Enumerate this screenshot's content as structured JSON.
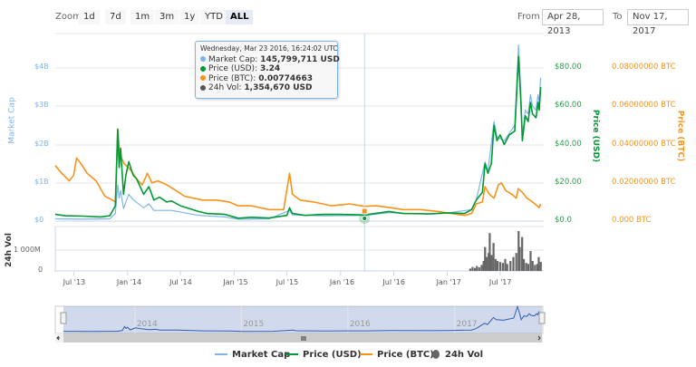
{
  "zoom": {
    "label": "Zoom",
    "buttons": [
      "1d",
      "7d",
      "1m",
      "3m",
      "1y",
      "YTD",
      "ALL"
    ],
    "selected": "ALL"
  },
  "range": {
    "from_label": "From",
    "from": "Apr 28, 2013",
    "to_label": "To",
    "to": "Nov 17, 2017"
  },
  "tooltip": {
    "date": "Wednesday, Mar 23 2016, 16:24:02 UTC",
    "rows": [
      {
        "label": "Market Cap:",
        "value": "145,799,711 USD",
        "color": "#7cb5ec"
      },
      {
        "label": "Price (USD):",
        "value": "3.24",
        "color": "#009933"
      },
      {
        "label": "Price (BTC):",
        "value": "0.00774663",
        "color": "#f7931a"
      },
      {
        "label": "24h Vol:",
        "value": "1,354,670 USD",
        "color": "#555555"
      }
    ]
  },
  "legend": [
    "Market Cap",
    "Price (USD)",
    "Price (BTC)",
    "24h Vol"
  ],
  "colors": {
    "market_cap": "#7cb5ec",
    "price_usd": "#009933",
    "price_btc": "#f7931a",
    "volume": "#666666"
  },
  "chart_data": {
    "type": "line",
    "x_range": [
      "2013-04-28",
      "2017-11-17"
    ],
    "crosshair_date": "2016-03-23",
    "x_ticks": [
      "Jul '13",
      "Jan '14",
      "Jul '14",
      "Jan '15",
      "Jul '15",
      "Jan '16",
      "Jul '16",
      "Jan '17",
      "Jul '17"
    ],
    "x_tick_dates": [
      "2013-07-01",
      "2014-01-01",
      "2014-07-01",
      "2015-01-01",
      "2015-07-01",
      "2016-01-01",
      "2016-07-01",
      "2017-01-01",
      "2017-07-01"
    ],
    "axes": {
      "market_cap": {
        "title": "Market Cap",
        "ticks": [
          "$0",
          "$1B",
          "$2B",
          "$3B",
          "$4B"
        ],
        "range": [
          0,
          4
        ]
      },
      "price_usd": {
        "title": "Price (USD)",
        "ticks": [
          "$0.0",
          "$20.00",
          "$40.00",
          "$60.00",
          "$80.00"
        ],
        "range": [
          0,
          80
        ]
      },
      "price_btc": {
        "title": "Price (BTC)",
        "ticks": [
          "0.000 BTC",
          "0.02000000 BTC",
          "0.04000000 BTC",
          "0.06000000 BTC",
          "0.08000000 BTC"
        ],
        "range": [
          0,
          0.08
        ]
      },
      "volume": {
        "title": "24h Vol",
        "ticks": [
          "0",
          "1 000M"
        ],
        "range": [
          0,
          2000
        ]
      }
    },
    "navigator_years": [
      "2014",
      "2015",
      "2016",
      "2017"
    ],
    "series": [
      {
        "name": "Price (USD)",
        "key": "price_usd",
        "points": [
          [
            "2013-04-28",
            3.5
          ],
          [
            "2013-06-01",
            2.8
          ],
          [
            "2013-08-01",
            2.6
          ],
          [
            "2013-10-01",
            2.2
          ],
          [
            "2013-11-01",
            2.8
          ],
          [
            "2013-11-20",
            8
          ],
          [
            "2013-11-28",
            48
          ],
          [
            "2013-12-03",
            28
          ],
          [
            "2013-12-08",
            38
          ],
          [
            "2013-12-18",
            14
          ],
          [
            "2013-12-26",
            24
          ],
          [
            "2014-01-05",
            31
          ],
          [
            "2014-01-20",
            24
          ],
          [
            "2014-02-01",
            22
          ],
          [
            "2014-02-25",
            14
          ],
          [
            "2014-03-15",
            18
          ],
          [
            "2014-04-01",
            11
          ],
          [
            "2014-04-20",
            12.5
          ],
          [
            "2014-05-15",
            10
          ],
          [
            "2014-06-01",
            10.5
          ],
          [
            "2014-07-01",
            8
          ],
          [
            "2014-09-01",
            5
          ],
          [
            "2014-10-01",
            4
          ],
          [
            "2014-12-01",
            3.5
          ],
          [
            "2015-01-15",
            1.5
          ],
          [
            "2015-03-01",
            2
          ],
          [
            "2015-05-01",
            1.6
          ],
          [
            "2015-07-01",
            3
          ],
          [
            "2015-07-10",
            7
          ],
          [
            "2015-07-20",
            4
          ],
          [
            "2015-09-01",
            3
          ],
          [
            "2015-11-01",
            3.5
          ],
          [
            "2016-01-01",
            3.5
          ],
          [
            "2016-03-23",
            3.24
          ],
          [
            "2016-06-15",
            5
          ],
          [
            "2016-08-01",
            4
          ],
          [
            "2016-11-01",
            3.8
          ],
          [
            "2017-01-01",
            4.3
          ],
          [
            "2017-03-01",
            4
          ],
          [
            "2017-03-25",
            6
          ],
          [
            "2017-04-10",
            11
          ],
          [
            "2017-05-01",
            15
          ],
          [
            "2017-05-10",
            30
          ],
          [
            "2017-05-20",
            25
          ],
          [
            "2017-06-01",
            30
          ],
          [
            "2017-06-10",
            50
          ],
          [
            "2017-06-20",
            42
          ],
          [
            "2017-07-01",
            45
          ],
          [
            "2017-07-15",
            40
          ],
          [
            "2017-08-01",
            45
          ],
          [
            "2017-08-20",
            47
          ],
          [
            "2017-09-02",
            86
          ],
          [
            "2017-09-10",
            62
          ],
          [
            "2017-09-15",
            42
          ],
          [
            "2017-09-25",
            55
          ],
          [
            "2017-10-05",
            52
          ],
          [
            "2017-10-13",
            62
          ],
          [
            "2017-10-20",
            56
          ],
          [
            "2017-11-01",
            54
          ],
          [
            "2017-11-08",
            62
          ],
          [
            "2017-11-12",
            58
          ],
          [
            "2017-11-17",
            70
          ]
        ]
      },
      {
        "name": "Market Cap",
        "key": "market_cap",
        "points": [
          [
            "2013-04-28",
            0.06
          ],
          [
            "2013-08-01",
            0.05
          ],
          [
            "2013-11-01",
            0.06
          ],
          [
            "2013-11-20",
            0.2
          ],
          [
            "2013-11-28",
            0.95
          ],
          [
            "2013-12-03",
            0.6
          ],
          [
            "2013-12-08",
            0.8
          ],
          [
            "2013-12-18",
            0.33
          ],
          [
            "2014-01-05",
            0.7
          ],
          [
            "2014-01-20",
            0.56
          ],
          [
            "2014-02-25",
            0.35
          ],
          [
            "2014-03-15",
            0.45
          ],
          [
            "2014-04-01",
            0.28
          ],
          [
            "2014-06-01",
            0.28
          ],
          [
            "2014-09-01",
            0.15
          ],
          [
            "2014-12-01",
            0.11
          ],
          [
            "2015-01-15",
            0.05
          ],
          [
            "2015-05-01",
            0.06
          ],
          [
            "2015-07-10",
            0.28
          ],
          [
            "2015-07-20",
            0.16
          ],
          [
            "2015-11-01",
            0.14
          ],
          [
            "2016-03-23",
            0.146
          ],
          [
            "2016-06-15",
            0.22
          ],
          [
            "2016-11-01",
            0.18
          ],
          [
            "2017-01-01",
            0.21
          ],
          [
            "2017-03-25",
            0.3
          ],
          [
            "2017-04-10",
            0.55
          ],
          [
            "2017-05-10",
            1.55
          ],
          [
            "2017-05-20",
            1.3
          ],
          [
            "2017-06-10",
            2.6
          ],
          [
            "2017-06-20",
            2.2
          ],
          [
            "2017-07-15",
            2.1
          ],
          [
            "2017-08-20",
            2.5
          ],
          [
            "2017-09-02",
            4.6
          ],
          [
            "2017-09-10",
            3.3
          ],
          [
            "2017-09-15",
            2.2
          ],
          [
            "2017-09-25",
            2.9
          ],
          [
            "2017-10-05",
            2.8
          ],
          [
            "2017-10-13",
            3.3
          ],
          [
            "2017-10-20",
            3.0
          ],
          [
            "2017-11-01",
            2.9
          ],
          [
            "2017-11-08",
            3.3
          ],
          [
            "2017-11-12",
            3.1
          ],
          [
            "2017-11-17",
            3.75
          ]
        ]
      },
      {
        "name": "Price (BTC)",
        "key": "price_btc",
        "points": [
          [
            "2013-04-28",
            0.029
          ],
          [
            "2013-05-20",
            0.025
          ],
          [
            "2013-06-15",
            0.021
          ],
          [
            "2013-06-30",
            0.024
          ],
          [
            "2013-07-10",
            0.033
          ],
          [
            "2013-07-25",
            0.03
          ],
          [
            "2013-08-15",
            0.025
          ],
          [
            "2013-09-15",
            0.021
          ],
          [
            "2013-10-15",
            0.013
          ],
          [
            "2013-11-10",
            0.011
          ],
          [
            "2013-11-20",
            0.01
          ],
          [
            "2013-11-28",
            0.048
          ],
          [
            "2013-12-05",
            0.035
          ],
          [
            "2013-12-20",
            0.03
          ],
          [
            "2014-01-10",
            0.027
          ],
          [
            "2014-02-01",
            0.022
          ],
          [
            "2014-02-20",
            0.019
          ],
          [
            "2014-03-10",
            0.025
          ],
          [
            "2014-03-25",
            0.02
          ],
          [
            "2014-04-15",
            0.021
          ],
          [
            "2014-05-15",
            0.019
          ],
          [
            "2014-06-15",
            0.016
          ],
          [
            "2014-07-15",
            0.013
          ],
          [
            "2014-08-15",
            0.012
          ],
          [
            "2014-09-15",
            0.011
          ],
          [
            "2014-11-01",
            0.011
          ],
          [
            "2014-12-15",
            0.01
          ],
          [
            "2015-01-15",
            0.008
          ],
          [
            "2015-03-01",
            0.008
          ],
          [
            "2015-05-01",
            0.006
          ],
          [
            "2015-06-20",
            0.006
          ],
          [
            "2015-07-10",
            0.025
          ],
          [
            "2015-07-20",
            0.014
          ],
          [
            "2015-08-15",
            0.011
          ],
          [
            "2015-10-01",
            0.01
          ],
          [
            "2015-12-01",
            0.008
          ],
          [
            "2016-02-01",
            0.009
          ],
          [
            "2016-03-23",
            0.0077
          ],
          [
            "2016-05-01",
            0.008
          ],
          [
            "2016-06-20",
            0.007
          ],
          [
            "2016-08-01",
            0.006
          ],
          [
            "2016-10-01",
            0.006
          ],
          [
            "2016-12-01",
            0.005
          ],
          [
            "2017-01-15",
            0.004
          ],
          [
            "2017-03-01",
            0.003
          ],
          [
            "2017-03-25",
            0.004
          ],
          [
            "2017-04-10",
            0.009
          ],
          [
            "2017-05-01",
            0.01
          ],
          [
            "2017-05-10",
            0.018
          ],
          [
            "2017-05-25",
            0.014
          ],
          [
            "2017-06-10",
            0.012
          ],
          [
            "2017-06-25",
            0.019
          ],
          [
            "2017-07-05",
            0.02
          ],
          [
            "2017-07-20",
            0.016
          ],
          [
            "2017-08-10",
            0.014
          ],
          [
            "2017-08-25",
            0.012
          ],
          [
            "2017-09-01",
            0.017
          ],
          [
            "2017-09-15",
            0.015
          ],
          [
            "2017-10-01",
            0.012
          ],
          [
            "2017-10-20",
            0.01
          ],
          [
            "2017-11-05",
            0.008
          ],
          [
            "2017-11-12",
            0.007
          ],
          [
            "2017-11-17",
            0.009
          ]
        ]
      },
      {
        "name": "24h Vol",
        "key": "volume",
        "unit": "M USD",
        "points": [
          [
            "2017-03-20",
            120
          ],
          [
            "2017-03-28",
            200
          ],
          [
            "2017-04-05",
            150
          ],
          [
            "2017-04-12",
            250
          ],
          [
            "2017-04-20",
            180
          ],
          [
            "2017-04-28",
            300
          ],
          [
            "2017-05-05",
            500
          ],
          [
            "2017-05-10",
            1200
          ],
          [
            "2017-05-15",
            700
          ],
          [
            "2017-05-22",
            900
          ],
          [
            "2017-05-26",
            1900
          ],
          [
            "2017-06-01",
            800
          ],
          [
            "2017-06-08",
            1400
          ],
          [
            "2017-06-15",
            600
          ],
          [
            "2017-06-22",
            500
          ],
          [
            "2017-07-01",
            450
          ],
          [
            "2017-07-10",
            400
          ],
          [
            "2017-07-18",
            600
          ],
          [
            "2017-07-25",
            350
          ],
          [
            "2017-08-05",
            500
          ],
          [
            "2017-08-15",
            700
          ],
          [
            "2017-08-25",
            900
          ],
          [
            "2017-09-02",
            2000
          ],
          [
            "2017-09-06",
            1200
          ],
          [
            "2017-09-14",
            1700
          ],
          [
            "2017-09-20",
            600
          ],
          [
            "2017-09-28",
            400
          ],
          [
            "2017-10-05",
            350
          ],
          [
            "2017-10-13",
            1000
          ],
          [
            "2017-10-20",
            500
          ],
          [
            "2017-10-28",
            300
          ],
          [
            "2017-11-05",
            350
          ],
          [
            "2017-11-10",
            700
          ],
          [
            "2017-11-17",
            450
          ]
        ]
      }
    ]
  }
}
